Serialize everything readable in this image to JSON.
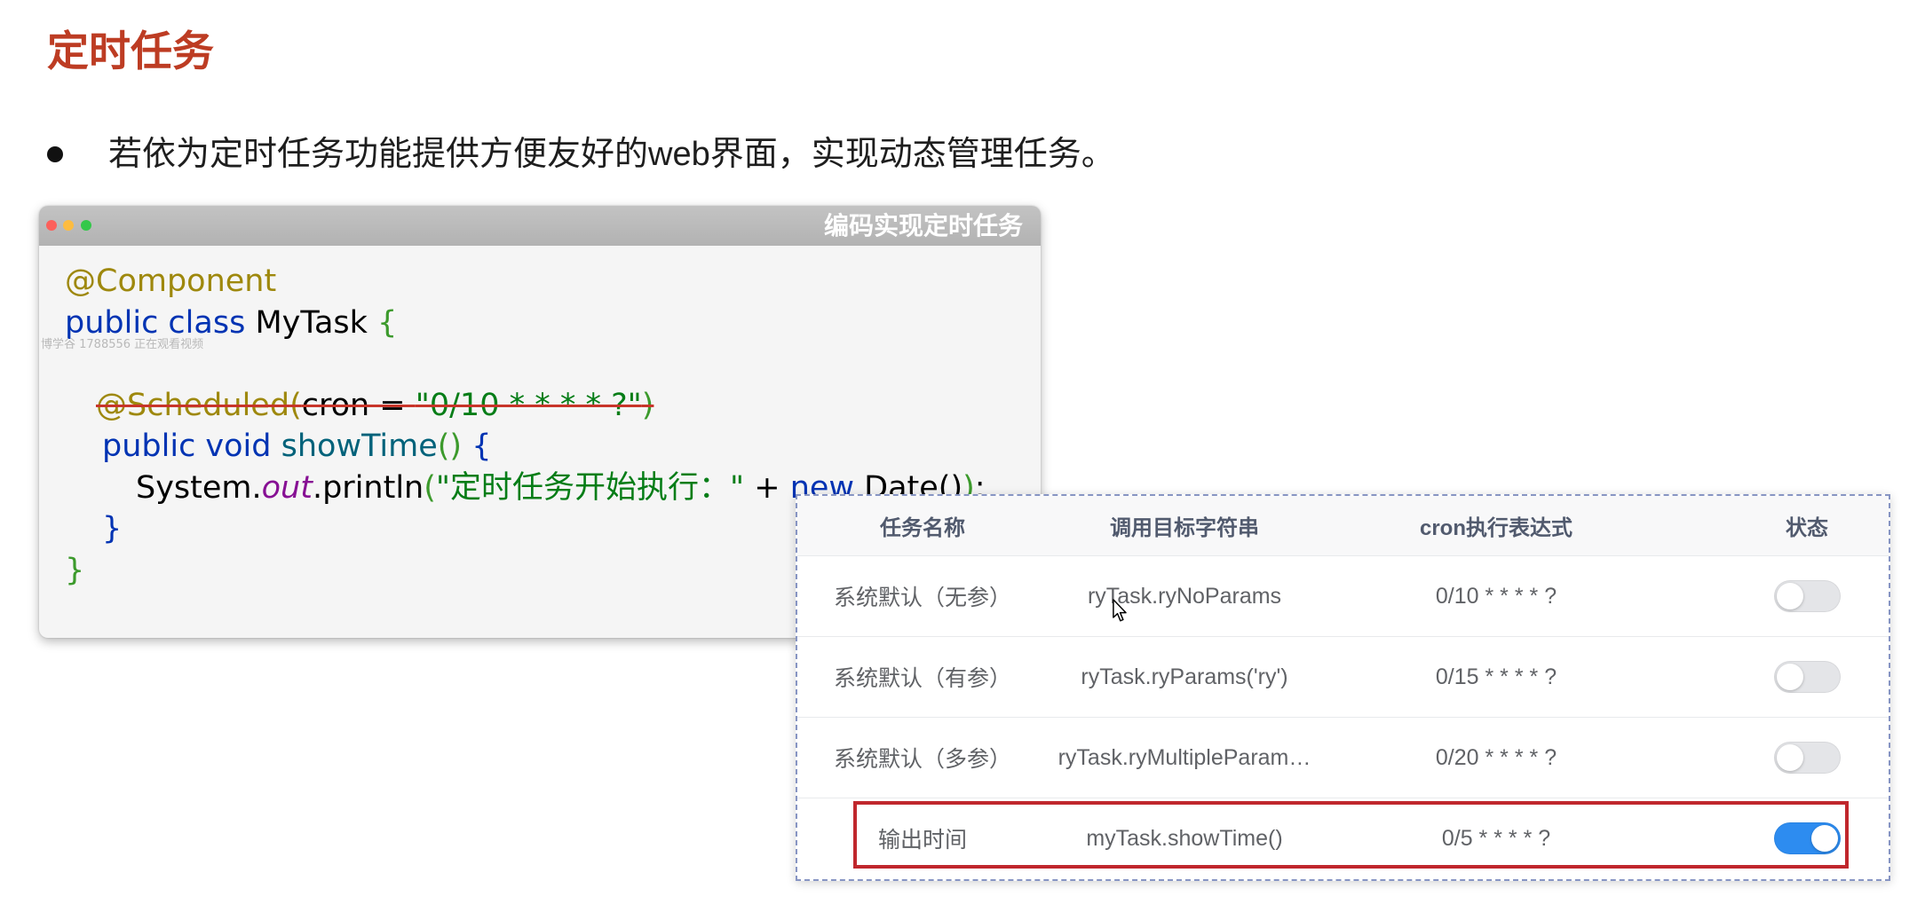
{
  "slide": {
    "title": "定时任务",
    "bullet_text": "若依为定时任务功能提供方便友好的web界面，实现动态管理任务。"
  },
  "code_window": {
    "title": "编码实现定时任务",
    "watermark": "博学谷 1788556 正在观看视频",
    "lines": [
      [
        "@Component"
      ],
      [
        "public class",
        " MyTask ",
        "{"
      ],
      [],
      [
        "@Scheduled",
        "(",
        "cron = ",
        "\"0/10 * * * * ?\"",
        ")"
      ],
      [
        "public void",
        " showTime",
        "()",
        " {"
      ],
      [
        "System.",
        "out",
        ".println",
        "(",
        "\"定时任务开始执行：\"",
        " + ",
        "new",
        " Date()",
        ")",
        ";"
      ],
      [
        "}"
      ],
      [
        "}"
      ]
    ]
  },
  "task_table": {
    "columns": {
      "name": "任务名称",
      "target": "调用目标字符串",
      "cron": "cron执行表达式",
      "status": "状态"
    },
    "rows": [
      {
        "name": "系统默认（无参）",
        "target": "ryTask.ryNoParams",
        "cron": "0/10 * * * * ?",
        "enabled": false
      },
      {
        "name": "系统默认（有参）",
        "target": "ryTask.ryParams('ry')",
        "cron": "0/15 * * * * ?",
        "enabled": false
      },
      {
        "name": "系统默认（多参）",
        "target": "ryTask.ryMultipleParam…",
        "cron": "0/20 * * * * ?",
        "enabled": false
      },
      {
        "name": "输出时间",
        "target": "myTask.showTime()",
        "cron": "0/5 * * * * ?",
        "enabled": true
      }
    ]
  },
  "icons": {
    "window_controls": [
      "close-button-icon",
      "minimize-button-icon",
      "maximize-button-icon"
    ],
    "cursor": "mouse-pointer-icon",
    "bullet": "bullet-dot-icon"
  },
  "colors": {
    "title": "#bd3c23",
    "text": "#1e1e1e",
    "annotation": "#9e880d",
    "keyword": "#0033b3",
    "string": "#067d17",
    "bracket_green": "#3c9a2c",
    "method": "#00627a",
    "field": "#871094",
    "strike": "#c8352a",
    "highlight_box": "#c0272d",
    "toggle_on": "#2d8cf0",
    "toggle_off": "#e4e5e8",
    "dot_close": "#fc605b",
    "dot_minimize": "#fdbc40",
    "dot_maximize": "#34c84a",
    "panel_border": "#8795c3"
  }
}
